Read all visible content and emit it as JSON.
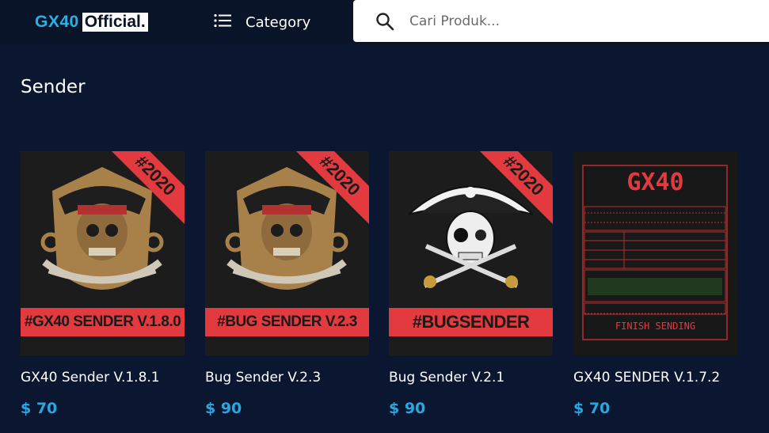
{
  "header": {
    "logo_primary": "GX40",
    "logo_secondary": "Official.",
    "category_label": "Category",
    "search_placeholder": "Cari Produk..."
  },
  "section": {
    "title": "Sender"
  },
  "products": [
    {
      "name": "GX40 Sender V.1.8.1",
      "price": "$ 70",
      "ribbon": "#2020",
      "banner": "#GX40 SENDER V.1.8.0"
    },
    {
      "name": "Bug Sender V.2.3",
      "price": "$ 90",
      "ribbon": "#2020",
      "banner": "#BUG SENDER V.2.3"
    },
    {
      "name": "Bug Sender V.2.1",
      "price": "$ 90",
      "ribbon": "#2020",
      "banner": "#BUGSENDER"
    },
    {
      "name": "GX40 SENDER V.1.7.2",
      "price": "$ 70",
      "term_title": "GX40",
      "term_footer": "FINISH SENDING"
    }
  ],
  "colors": {
    "background": "#0b1730",
    "topbar": "#0a1428",
    "accent_blue": "#29a7e0",
    "ribbon_red": "#e23a3e"
  },
  "icons": {
    "menu": "list-icon",
    "search": "search-icon"
  }
}
